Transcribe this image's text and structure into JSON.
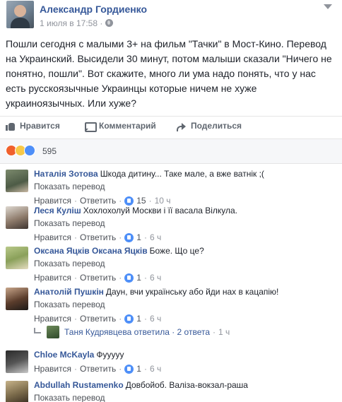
{
  "post": {
    "author": "Александр Гордиенко",
    "time": "1 июля в 17:58",
    "dot": "·",
    "text": "Пошли сегодня с малыми 3+ на фильм \"Тачки\" в Мост-Кино. Перевод на Украинский. Высидели 30 минут, потом малыши сказали \"Ничего не понятно, пошли\". Вот скажите, много ли ума надо понять, что у нас есть русскоязычные Украинцы которые ничем не хуже украиноязычных. Или хуже?"
  },
  "actions": {
    "like": "Нравится",
    "comment": "Комментарий",
    "share": "Поделиться"
  },
  "reactions": {
    "count": "595",
    "icons": [
      "angry-icon",
      "haha-icon",
      "like-icon"
    ]
  },
  "comment_labels": {
    "translate": "Показать перевод",
    "like": "Нравится",
    "reply": "Ответить",
    "sep": "·"
  },
  "comments": [
    {
      "name": "Наталія Зотова",
      "text": "Шкода дитину... Таке мале, а вже ватнік ;(",
      "likes": "15",
      "time": "10 ч"
    },
    {
      "name": "Леся Куліш",
      "text": "Хохлохолуй Москви і її васала Вілкула.",
      "likes": "1",
      "time": "6 ч"
    },
    {
      "name": "Оксана Яцків Оксана Яцків",
      "text": "Боже. Що це?",
      "likes": "1",
      "time": "6 ч"
    },
    {
      "name": "Анатолій Пушкін",
      "text": "Даун, вчи українську або йди нах в кацапію!",
      "likes": "1",
      "time": "6 ч"
    },
    {
      "name": "Chloe McKayla",
      "text": "Фууууу",
      "likes": "1",
      "time": "6 ч"
    },
    {
      "name": "Abdullah Rustamenko",
      "text": "Довбойоб. Валіза-вокзал-раша"
    }
  ],
  "replies": {
    "text": "Таня Кудрявцева ответила · 2 ответа",
    "time": "1 ч"
  },
  "colors": {
    "link_blue": "#365899",
    "text": "#1d2129",
    "muted": "#90949c",
    "like_blue": "#4e8ff8"
  }
}
